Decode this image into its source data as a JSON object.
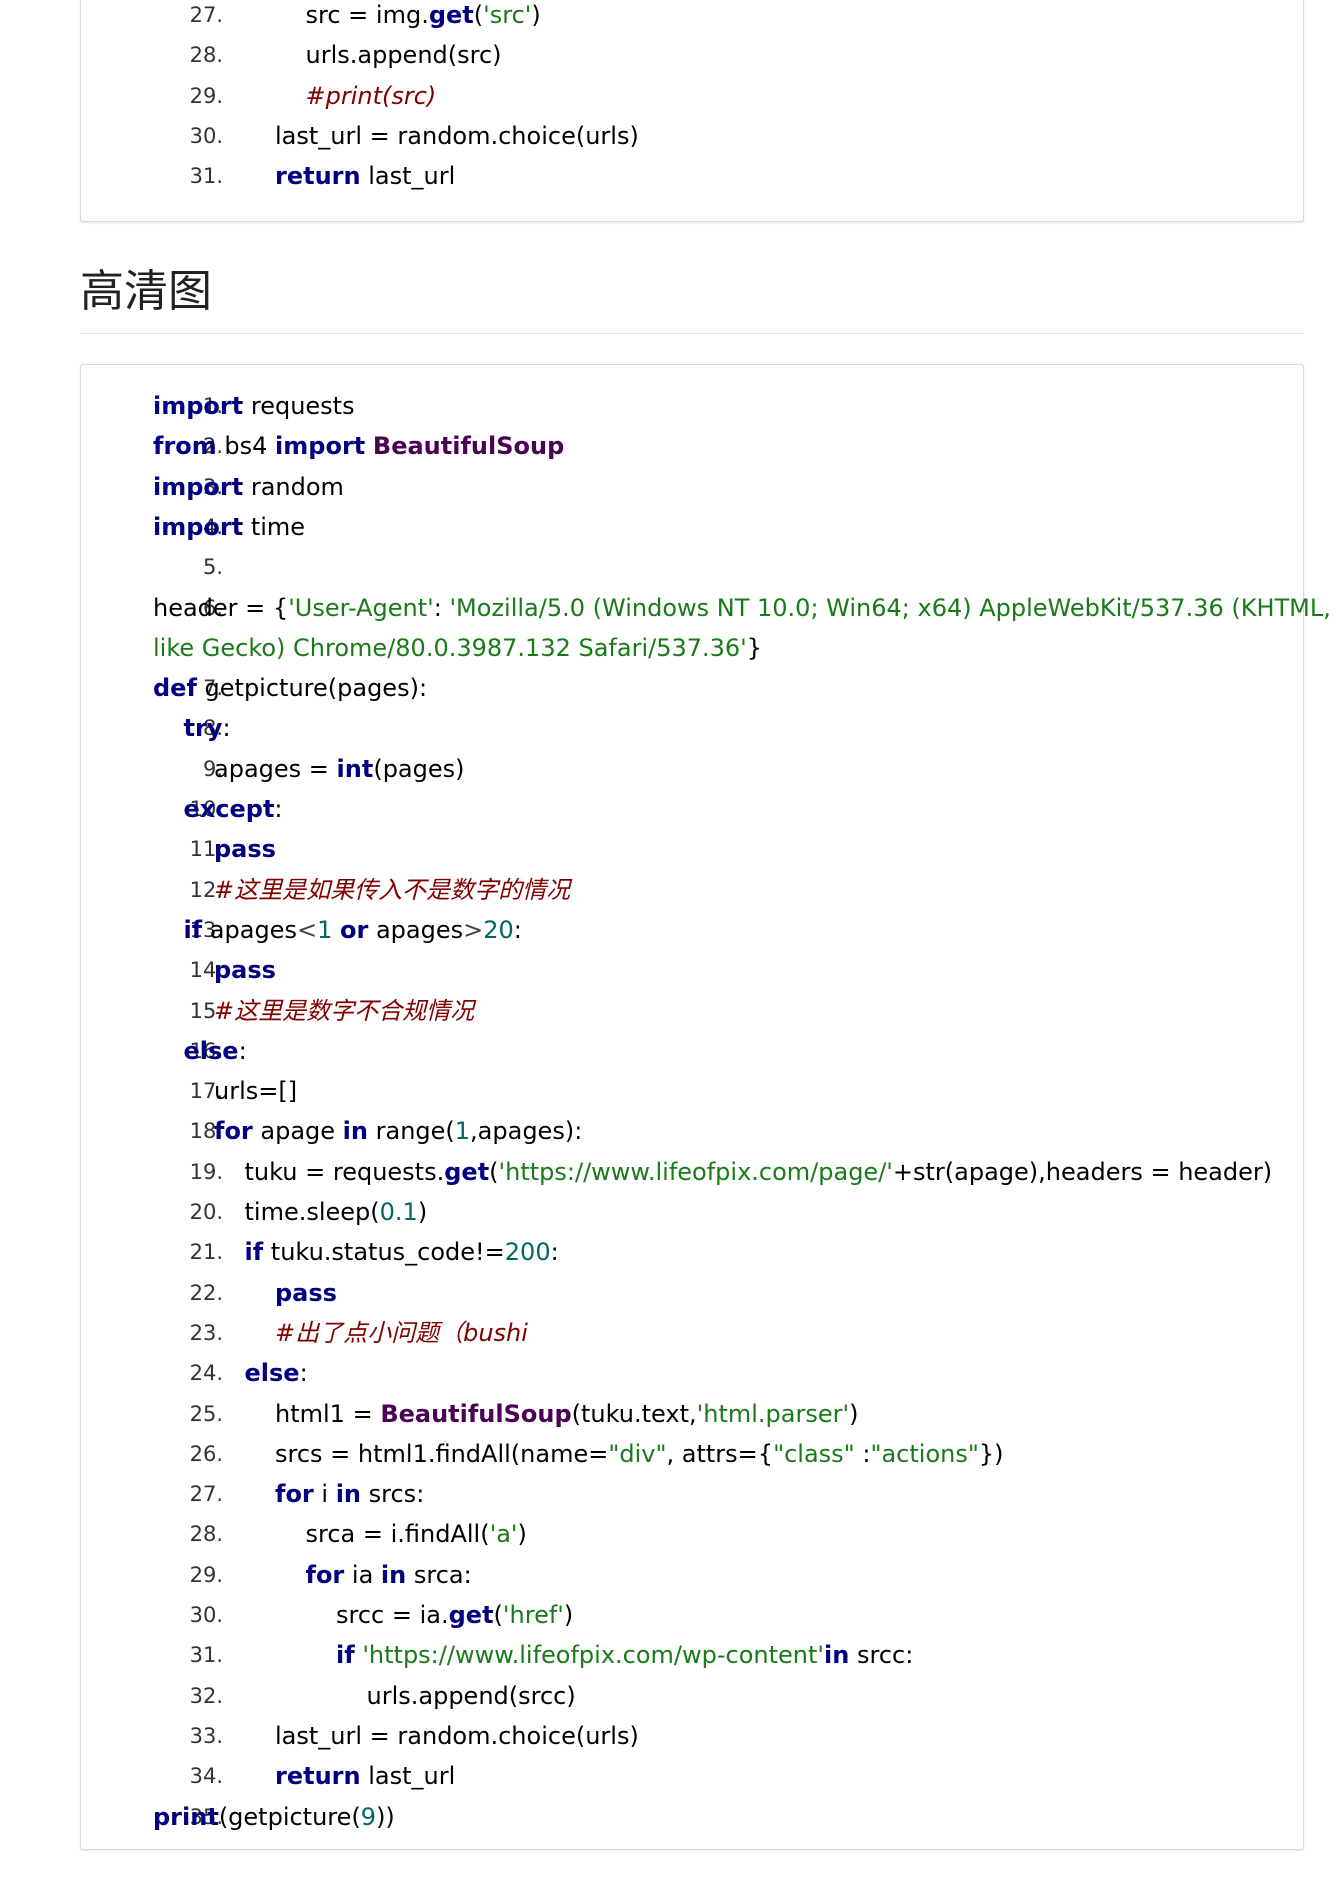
{
  "top_block": {
    "lines": [
      {
        "n": "27.",
        "indent": 5,
        "tokens": [
          [
            "src = img.",
            ""
          ],
          [
            "get",
            "k"
          ],
          [
            "(",
            ""
          ],
          [
            "'src'",
            "s"
          ],
          [
            ")",
            ""
          ]
        ]
      },
      {
        "n": "28.",
        "indent": 5,
        "tokens": [
          [
            "urls.append(src)",
            ""
          ]
        ]
      },
      {
        "n": "29.",
        "indent": 5,
        "tokens": [
          [
            "#print(src)",
            "c"
          ]
        ]
      },
      {
        "n": "30.",
        "indent": 4,
        "tokens": [
          [
            "last_url = random.choice(urls)",
            ""
          ]
        ]
      },
      {
        "n": "31.",
        "indent": 4,
        "tokens": [
          [
            "return",
            "k"
          ],
          [
            " last_url",
            ""
          ]
        ]
      }
    ]
  },
  "section": {
    "heading": "高清图"
  },
  "main_block": {
    "lines": [
      {
        "n": "1.",
        "indent": 0,
        "tokens": [
          [
            "import",
            "k"
          ],
          [
            " requests",
            ""
          ]
        ]
      },
      {
        "n": "2.",
        "indent": 0,
        "tokens": [
          [
            "from",
            "k"
          ],
          [
            " bs4 ",
            ""
          ],
          [
            "import",
            "k"
          ],
          [
            " ",
            ""
          ],
          [
            "BeautifulSoup",
            "cl"
          ]
        ]
      },
      {
        "n": "3.",
        "indent": 0,
        "tokens": [
          [
            "import",
            "k"
          ],
          [
            " random",
            ""
          ]
        ]
      },
      {
        "n": "4.",
        "indent": 0,
        "tokens": [
          [
            "import",
            "k"
          ],
          [
            " time",
            ""
          ]
        ]
      },
      {
        "n": "5.",
        "indent": 0,
        "tokens": []
      },
      {
        "n": "6.",
        "indent": 0,
        "tokens": [
          [
            "header = {",
            ""
          ],
          [
            "'User-Agent'",
            "s"
          ],
          [
            ": ",
            ""
          ],
          [
            "'Mozilla/5.0 (Windows NT 10.0; Win64; x64) AppleWebKit/537.36 (KHTML,",
            "s"
          ]
        ]
      },
      {
        "n": "",
        "indent": 0,
        "tokens": [
          [
            "like Gecko) Chrome/80.0.3987.132 Safari/537.36'",
            "s"
          ],
          [
            "}",
            ""
          ]
        ]
      },
      {
        "n": "7.",
        "indent": 0,
        "tokens": [
          [
            "def",
            "k"
          ],
          [
            " getpicture(pages):",
            ""
          ]
        ]
      },
      {
        "n": "8.",
        "indent": 1,
        "tokens": [
          [
            "try",
            "k"
          ],
          [
            ":",
            ""
          ]
        ]
      },
      {
        "n": "9.",
        "indent": 2,
        "tokens": [
          [
            "apages = ",
            ""
          ],
          [
            "int",
            "k"
          ],
          [
            "(pages)",
            ""
          ]
        ]
      },
      {
        "n": "10.",
        "indent": 1,
        "tokens": [
          [
            "except",
            "k"
          ],
          [
            ":",
            ""
          ]
        ]
      },
      {
        "n": "11.",
        "indent": 2,
        "tokens": [
          [
            "pass",
            "k"
          ]
        ]
      },
      {
        "n": "12.",
        "indent": 2,
        "tokens": [
          [
            "#这里是如果传入不是数字的情况",
            "c"
          ]
        ]
      },
      {
        "n": "13.",
        "indent": 1,
        "tokens": [
          [
            "if",
            "k"
          ],
          [
            " apages",
            ""
          ],
          [
            "<",
            "p"
          ],
          [
            "1",
            "n"
          ],
          [
            " ",
            ""
          ],
          [
            "or",
            "k"
          ],
          [
            " apages",
            ""
          ],
          [
            ">",
            "p"
          ],
          [
            "20",
            "n"
          ],
          [
            ":",
            ""
          ]
        ]
      },
      {
        "n": "14.",
        "indent": 2,
        "tokens": [
          [
            "pass",
            "k"
          ]
        ]
      },
      {
        "n": "15.",
        "indent": 2,
        "tokens": [
          [
            "#这里是数字不合规情况",
            "c"
          ]
        ]
      },
      {
        "n": "16.",
        "indent": 1,
        "tokens": [
          [
            "else",
            "k"
          ],
          [
            ":",
            ""
          ]
        ]
      },
      {
        "n": "17.",
        "indent": 2,
        "tokens": [
          [
            "urls=[]",
            ""
          ]
        ]
      },
      {
        "n": "18.",
        "indent": 2,
        "tokens": [
          [
            "for",
            "k"
          ],
          [
            " apage ",
            ""
          ],
          [
            "in",
            "k"
          ],
          [
            " range(",
            ""
          ],
          [
            "1",
            "n"
          ],
          [
            ",apages):",
            ""
          ]
        ]
      },
      {
        "n": "19.",
        "indent": 3,
        "tokens": [
          [
            "tuku = requests.",
            ""
          ],
          [
            "get",
            "k"
          ],
          [
            "(",
            ""
          ],
          [
            "'https://www.lifeofpix.com/page/'",
            "s"
          ],
          [
            "+str(apage),headers = header)",
            ""
          ]
        ]
      },
      {
        "n": "20.",
        "indent": 3,
        "tokens": [
          [
            "time.sleep(",
            ""
          ],
          [
            "0.1",
            "n"
          ],
          [
            ")",
            ""
          ]
        ]
      },
      {
        "n": "21.",
        "indent": 3,
        "tokens": [
          [
            "if",
            "k"
          ],
          [
            " tuku.status_code!=",
            ""
          ],
          [
            "200",
            "n"
          ],
          [
            ":",
            ""
          ]
        ]
      },
      {
        "n": "22.",
        "indent": 4,
        "tokens": [
          [
            "pass",
            "k"
          ]
        ]
      },
      {
        "n": "23.",
        "indent": 4,
        "tokens": [
          [
            "#出了点小问题（bushi",
            "c"
          ]
        ]
      },
      {
        "n": "24.",
        "indent": 3,
        "tokens": [
          [
            "else",
            "k"
          ],
          [
            ":",
            ""
          ]
        ]
      },
      {
        "n": "25.",
        "indent": 4,
        "tokens": [
          [
            "html1 = ",
            ""
          ],
          [
            "BeautifulSoup",
            "cl"
          ],
          [
            "(tuku.text,",
            ""
          ],
          [
            "'html.parser'",
            "s"
          ],
          [
            ")",
            ""
          ]
        ]
      },
      {
        "n": "26.",
        "indent": 4,
        "tokens": [
          [
            "srcs = html1.findAll(name=",
            ""
          ],
          [
            "\"div\"",
            "s"
          ],
          [
            ", attrs={",
            ""
          ],
          [
            "\"class\"",
            "s"
          ],
          [
            " :",
            ""
          ],
          [
            "\"actions\"",
            "s"
          ],
          [
            "})",
            ""
          ]
        ]
      },
      {
        "n": "27.",
        "indent": 4,
        "tokens": [
          [
            "for",
            "k"
          ],
          [
            " i ",
            ""
          ],
          [
            "in",
            "k"
          ],
          [
            " srcs:",
            ""
          ]
        ]
      },
      {
        "n": "28.",
        "indent": 5,
        "tokens": [
          [
            "srca = i.findAll(",
            ""
          ],
          [
            "'a'",
            "s"
          ],
          [
            ")",
            ""
          ]
        ]
      },
      {
        "n": "29.",
        "indent": 5,
        "tokens": [
          [
            "for",
            "k"
          ],
          [
            " ia ",
            ""
          ],
          [
            "in",
            "k"
          ],
          [
            " srca:",
            ""
          ]
        ]
      },
      {
        "n": "30.",
        "indent": 6,
        "tokens": [
          [
            "srcc = ia.",
            ""
          ],
          [
            "get",
            "k"
          ],
          [
            "(",
            ""
          ],
          [
            "'href'",
            "s"
          ],
          [
            ")",
            ""
          ]
        ]
      },
      {
        "n": "31.",
        "indent": 6,
        "tokens": [
          [
            "if",
            "k"
          ],
          [
            " ",
            ""
          ],
          [
            "'https://www.lifeofpix.com/wp-content'",
            "s"
          ],
          [
            "in",
            "k"
          ],
          [
            " srcc:",
            ""
          ]
        ]
      },
      {
        "n": "32.",
        "indent": 7,
        "tokens": [
          [
            "urls.append(srcc)",
            ""
          ]
        ]
      },
      {
        "n": "33.",
        "indent": 4,
        "tokens": [
          [
            "last_url = random.choice(urls)",
            ""
          ]
        ]
      },
      {
        "n": "34.",
        "indent": 4,
        "tokens": [
          [
            "return",
            "k"
          ],
          [
            " last_url",
            ""
          ]
        ]
      },
      {
        "n": "35.",
        "indent": 0,
        "tokens": [
          [
            "print",
            "k"
          ],
          [
            "(getpicture(",
            ""
          ],
          [
            "9",
            "n"
          ],
          [
            "))",
            ""
          ]
        ]
      }
    ]
  }
}
